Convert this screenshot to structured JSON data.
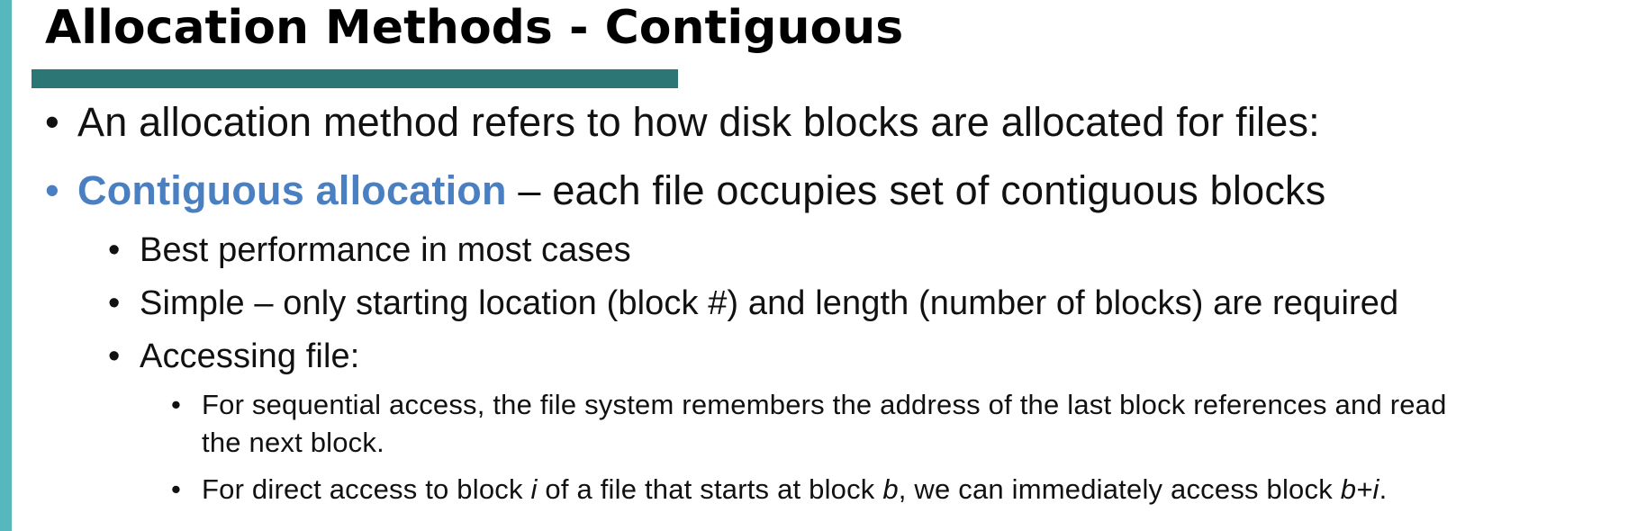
{
  "slide": {
    "title": "Allocation Methods - Contiguous",
    "bullets": {
      "b1": "An allocation method refers to how disk blocks are allocated for files:",
      "b2_highlight": "Contiguous allocation",
      "b2_rest": " – each file occupies set of contiguous blocks",
      "b2_sub1": "Best performance in most cases",
      "b2_sub2": "Simple – only starting location (block #) and length (number of blocks) are required",
      "b2_sub3": "Accessing file:",
      "b3_sub1_line1": "For sequential access, the file system remembers the address of the last block references and read",
      "b3_sub1_line2": "the next block.",
      "b3_sub2_a": "For direct access to block ",
      "b3_sub2_i": "i",
      "b3_sub2_b": " of a file that starts at block ",
      "b3_sub2_bvar": "b",
      "b3_sub2_c": ", we can immediately access block ",
      "b3_sub2_expr": "b+i",
      "b3_sub2_end": "."
    },
    "bullet_glyph": "•",
    "colors": {
      "accent_bar": "#56b8bc",
      "title_underline": "#2d7676",
      "highlight_text": "#4a7fc1"
    }
  }
}
